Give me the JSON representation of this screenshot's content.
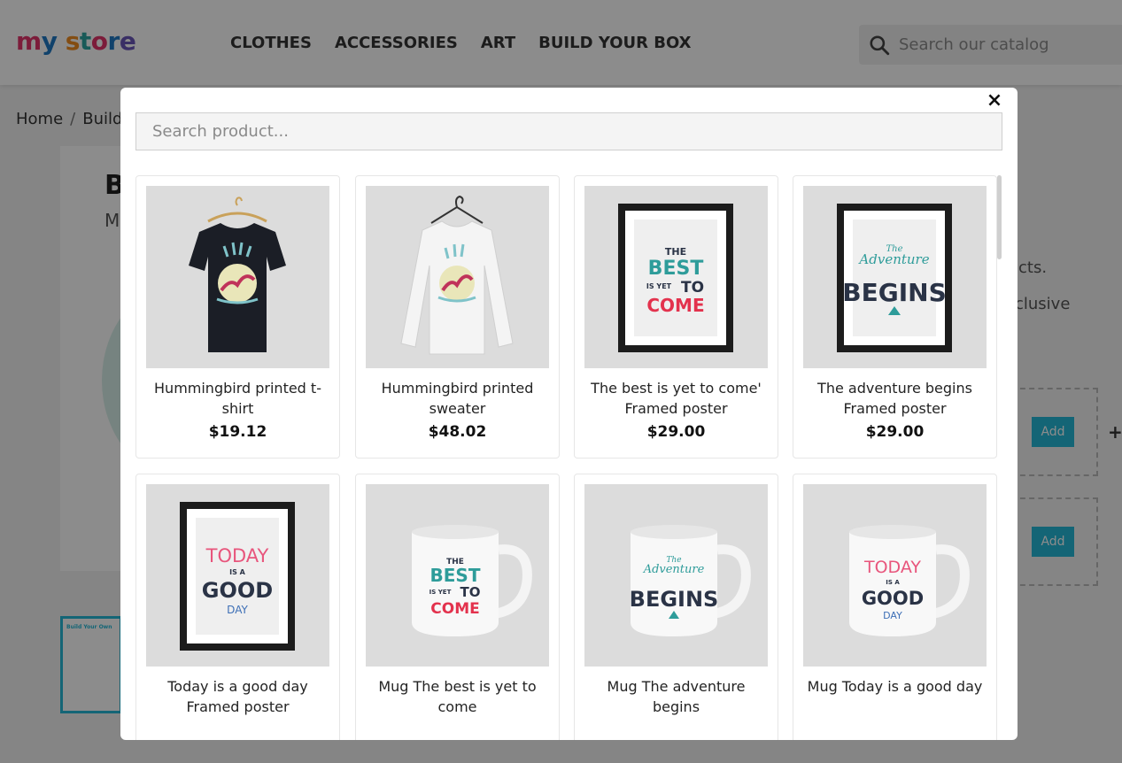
{
  "store": {
    "logo_text": {
      "p1": "m",
      "p2": "y",
      "p3": " s",
      "p4": "t",
      "p5": "o",
      "p6": "r",
      "p7": "e"
    },
    "nav": [
      "CLOTHES",
      "ACCESSORIES",
      "ART",
      "BUILD YOUR BOX"
    ],
    "search_placeholder": "Search our catalog",
    "breadcrumb": {
      "home": "Home",
      "sep": "/",
      "current": "Build"
    },
    "bg_title": "B",
    "bg_sub": "M",
    "bg_right1": "cts.",
    "bg_right2": "clusive",
    "add_label": "Add",
    "plus": "+",
    "thumb_text": "Build Your Own"
  },
  "modal": {
    "close_label": "×",
    "search_placeholder": "Search product...",
    "products": [
      {
        "name": "Hummingbird printed t-shirt",
        "price": "$19.12",
        "type": "tshirt"
      },
      {
        "name": "Hummingbird printed sweater",
        "price": "$48.02",
        "type": "sweater"
      },
      {
        "name": "The best is yet to come' Framed poster",
        "price": "$29.00",
        "type": "poster-best"
      },
      {
        "name": "The adventure begins Framed poster",
        "price": "$29.00",
        "type": "poster-adventure"
      },
      {
        "name": "Today is a good day Framed poster",
        "price": "",
        "type": "poster-today"
      },
      {
        "name": "Mug The best is yet to come",
        "price": "",
        "type": "mug-best"
      },
      {
        "name": "Mug The adventure begins",
        "price": "",
        "type": "mug-adventure"
      },
      {
        "name": "Mug Today is a good day",
        "price": "",
        "type": "mug-today"
      }
    ],
    "art": {
      "best": {
        "l1": "THE",
        "l2": "BEST",
        "l3": "IS YET",
        "l4": "TO",
        "l5": "COME"
      },
      "adventure": {
        "l1": "The",
        "l2": "Adventure",
        "l3": "BEGINS"
      },
      "today": {
        "l1": "TODAY",
        "l2": "IS A",
        "l3": "GOOD",
        "l4": "DAY"
      }
    },
    "colors": {
      "teal": "#2e9c9a",
      "red": "#e3324d",
      "pink": "#e8557c",
      "navy": "#2a3346",
      "blue": "#3d6fb6"
    }
  }
}
